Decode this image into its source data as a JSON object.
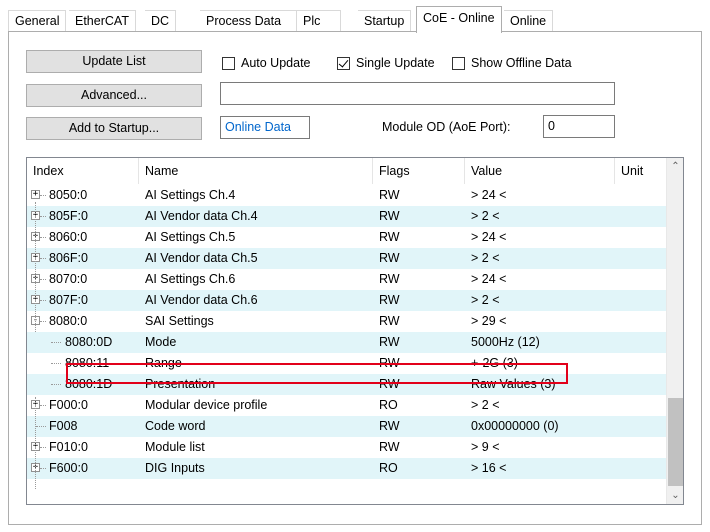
{
  "tabs": [
    {
      "label": "General"
    },
    {
      "label": "EtherCAT"
    },
    {
      "label": "DC"
    },
    {
      "label": "Process Data"
    },
    {
      "label": "Plc"
    },
    {
      "label": "Startup"
    },
    {
      "label": "CoE - Online",
      "active": true
    },
    {
      "label": "Online"
    }
  ],
  "controls": {
    "update_list": "Update List",
    "advanced": "Advanced...",
    "add_to_startup": "Add to Startup...",
    "auto_update": "Auto Update",
    "single_update": "Single Update",
    "show_offline": "Show Offline Data",
    "online_data": "Online Data",
    "module_od_label": "Module OD (AoE Port):",
    "module_od_value": "0",
    "auto_update_checked": false,
    "single_update_checked": true,
    "show_offline_checked": false
  },
  "table": {
    "columns": [
      "Index",
      "Name",
      "Flags",
      "Value",
      "Unit"
    ],
    "rows": [
      {
        "index": "8050:0",
        "name": "AI Settings Ch.4",
        "flags": "RW",
        "value": "> 24 <",
        "unit": "",
        "expander": "+"
      },
      {
        "index": "805F:0",
        "name": "AI Vendor data Ch.4",
        "flags": "RW",
        "value": "> 2 <",
        "unit": "",
        "expander": "+"
      },
      {
        "index": "8060:0",
        "name": "AI Settings Ch.5",
        "flags": "RW",
        "value": "> 24 <",
        "unit": "",
        "expander": "+"
      },
      {
        "index": "806F:0",
        "name": "AI Vendor data Ch.5",
        "flags": "RW",
        "value": "> 2 <",
        "unit": "",
        "expander": "+"
      },
      {
        "index": "8070:0",
        "name": "AI Settings Ch.6",
        "flags": "RW",
        "value": "> 24 <",
        "unit": "",
        "expander": "+"
      },
      {
        "index": "807F:0",
        "name": "AI Vendor data Ch.6",
        "flags": "RW",
        "value": "> 2 <",
        "unit": "",
        "expander": "+"
      },
      {
        "index": "8080:0",
        "name": "SAI Settings",
        "flags": "RW",
        "value": "> 29 <",
        "unit": "",
        "expander": "-"
      },
      {
        "index": "8080:0D",
        "name": "Mode",
        "flags": "RW",
        "value": "5000Hz (12)",
        "unit": "",
        "child": true
      },
      {
        "index": "8080:11",
        "name": "Range",
        "flags": "RW",
        "value": "+-2G (3)",
        "unit": "",
        "child": true,
        "highlighted": true
      },
      {
        "index": "8080:1D",
        "name": "Presentation",
        "flags": "RW",
        "value": "Raw Values (3)",
        "unit": "",
        "child": true
      },
      {
        "index": "F000:0",
        "name": "Modular device profile",
        "flags": "RO",
        "value": "> 2 <",
        "unit": "",
        "expander": "+"
      },
      {
        "index": "F008",
        "name": "Code word",
        "flags": "RW",
        "value": "0x00000000 (0)",
        "unit": ""
      },
      {
        "index": "F010:0",
        "name": "Module list",
        "flags": "RW",
        "value": "> 9 <",
        "unit": "",
        "expander": "+"
      },
      {
        "index": "F600:0",
        "name": "DIG Inputs",
        "flags": "RO",
        "value": "> 16 <",
        "unit": "",
        "expander": "+"
      }
    ]
  },
  "colors": {
    "alt_row": "#e1f5f9",
    "highlight_border": "#e2001a",
    "online_data_text": "#0066cc"
  }
}
